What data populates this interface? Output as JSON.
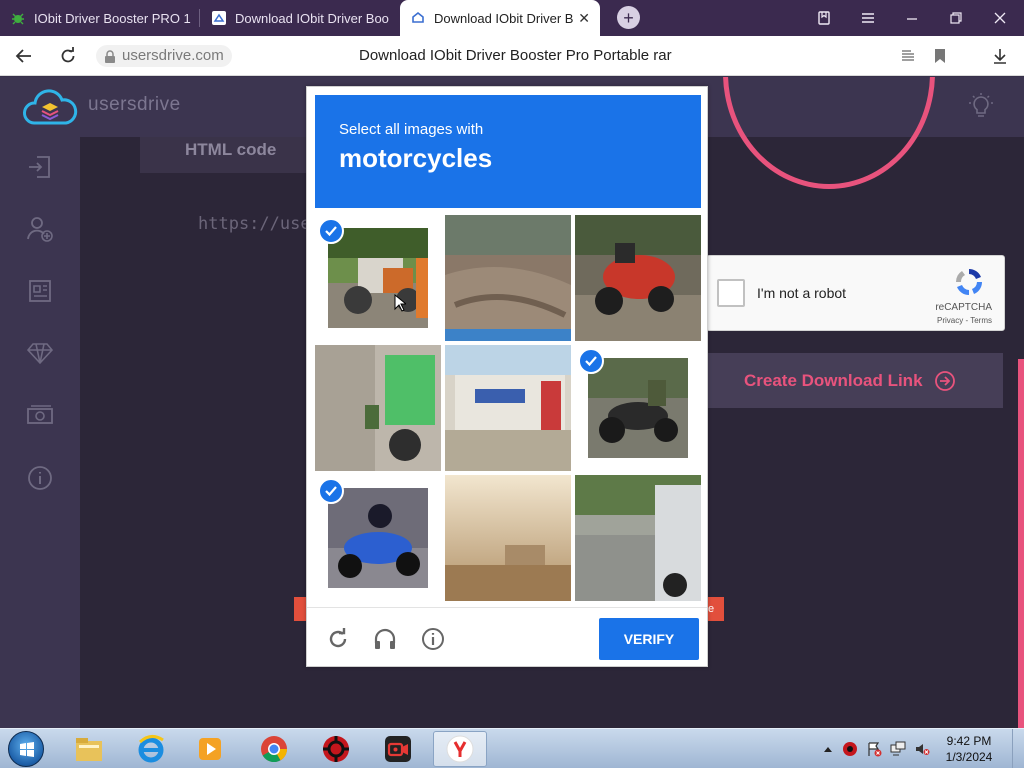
{
  "browser": {
    "tabs": [
      {
        "title": "IObit Driver Booster PRO 1",
        "active": false,
        "icon": "bug-green-icon"
      },
      {
        "title": "Download IObit Driver Boo",
        "active": false,
        "icon": "usersdrive-favicon"
      },
      {
        "title": "Download IObit Driver B",
        "active": true,
        "icon": "usersdrive-favicon"
      }
    ],
    "new_tab_label": "+",
    "address": {
      "domain": "usersdrive.com",
      "page_title": "Download IObit Driver Booster Pro Portable rar"
    }
  },
  "site": {
    "brand": "usersdrive",
    "html_code_tab": "HTML code",
    "url_fragment": "https://users",
    "robot_label": "I'm not a robot",
    "recaptcha_brand": "reCAPTCHA",
    "recaptcha_links": "Privacy - Terms",
    "create_button": "Create Download Link",
    "red_strip_fragment": "e"
  },
  "captcha": {
    "instruction": "Select all images with",
    "target": "motorcycles",
    "tiles": [
      {
        "label": "road roller",
        "selected": true
      },
      {
        "label": "dirt road",
        "selected": false
      },
      {
        "label": "red motorcycle",
        "selected": false
      },
      {
        "label": "green scooter",
        "selected": false
      },
      {
        "label": "street shops",
        "selected": false
      },
      {
        "label": "motorcycle rider",
        "selected": true
      },
      {
        "label": "blue motorcycle",
        "selected": true
      },
      {
        "label": "hazy field",
        "selected": false
      },
      {
        "label": "car on road",
        "selected": false
      }
    ],
    "verify_label": "VERIFY"
  },
  "taskbar": {
    "apps": [
      "explorer-icon",
      "ie-icon",
      "media-player-icon",
      "chrome-icon",
      "recovery-icon",
      "recorder-icon",
      "yandex-icon"
    ],
    "time": "9:42 PM",
    "date": "1/3/2024"
  },
  "colors": {
    "accent": "#1a73e8",
    "site_pink": "#e8537d",
    "browser_frame": "#3b2a4f"
  }
}
